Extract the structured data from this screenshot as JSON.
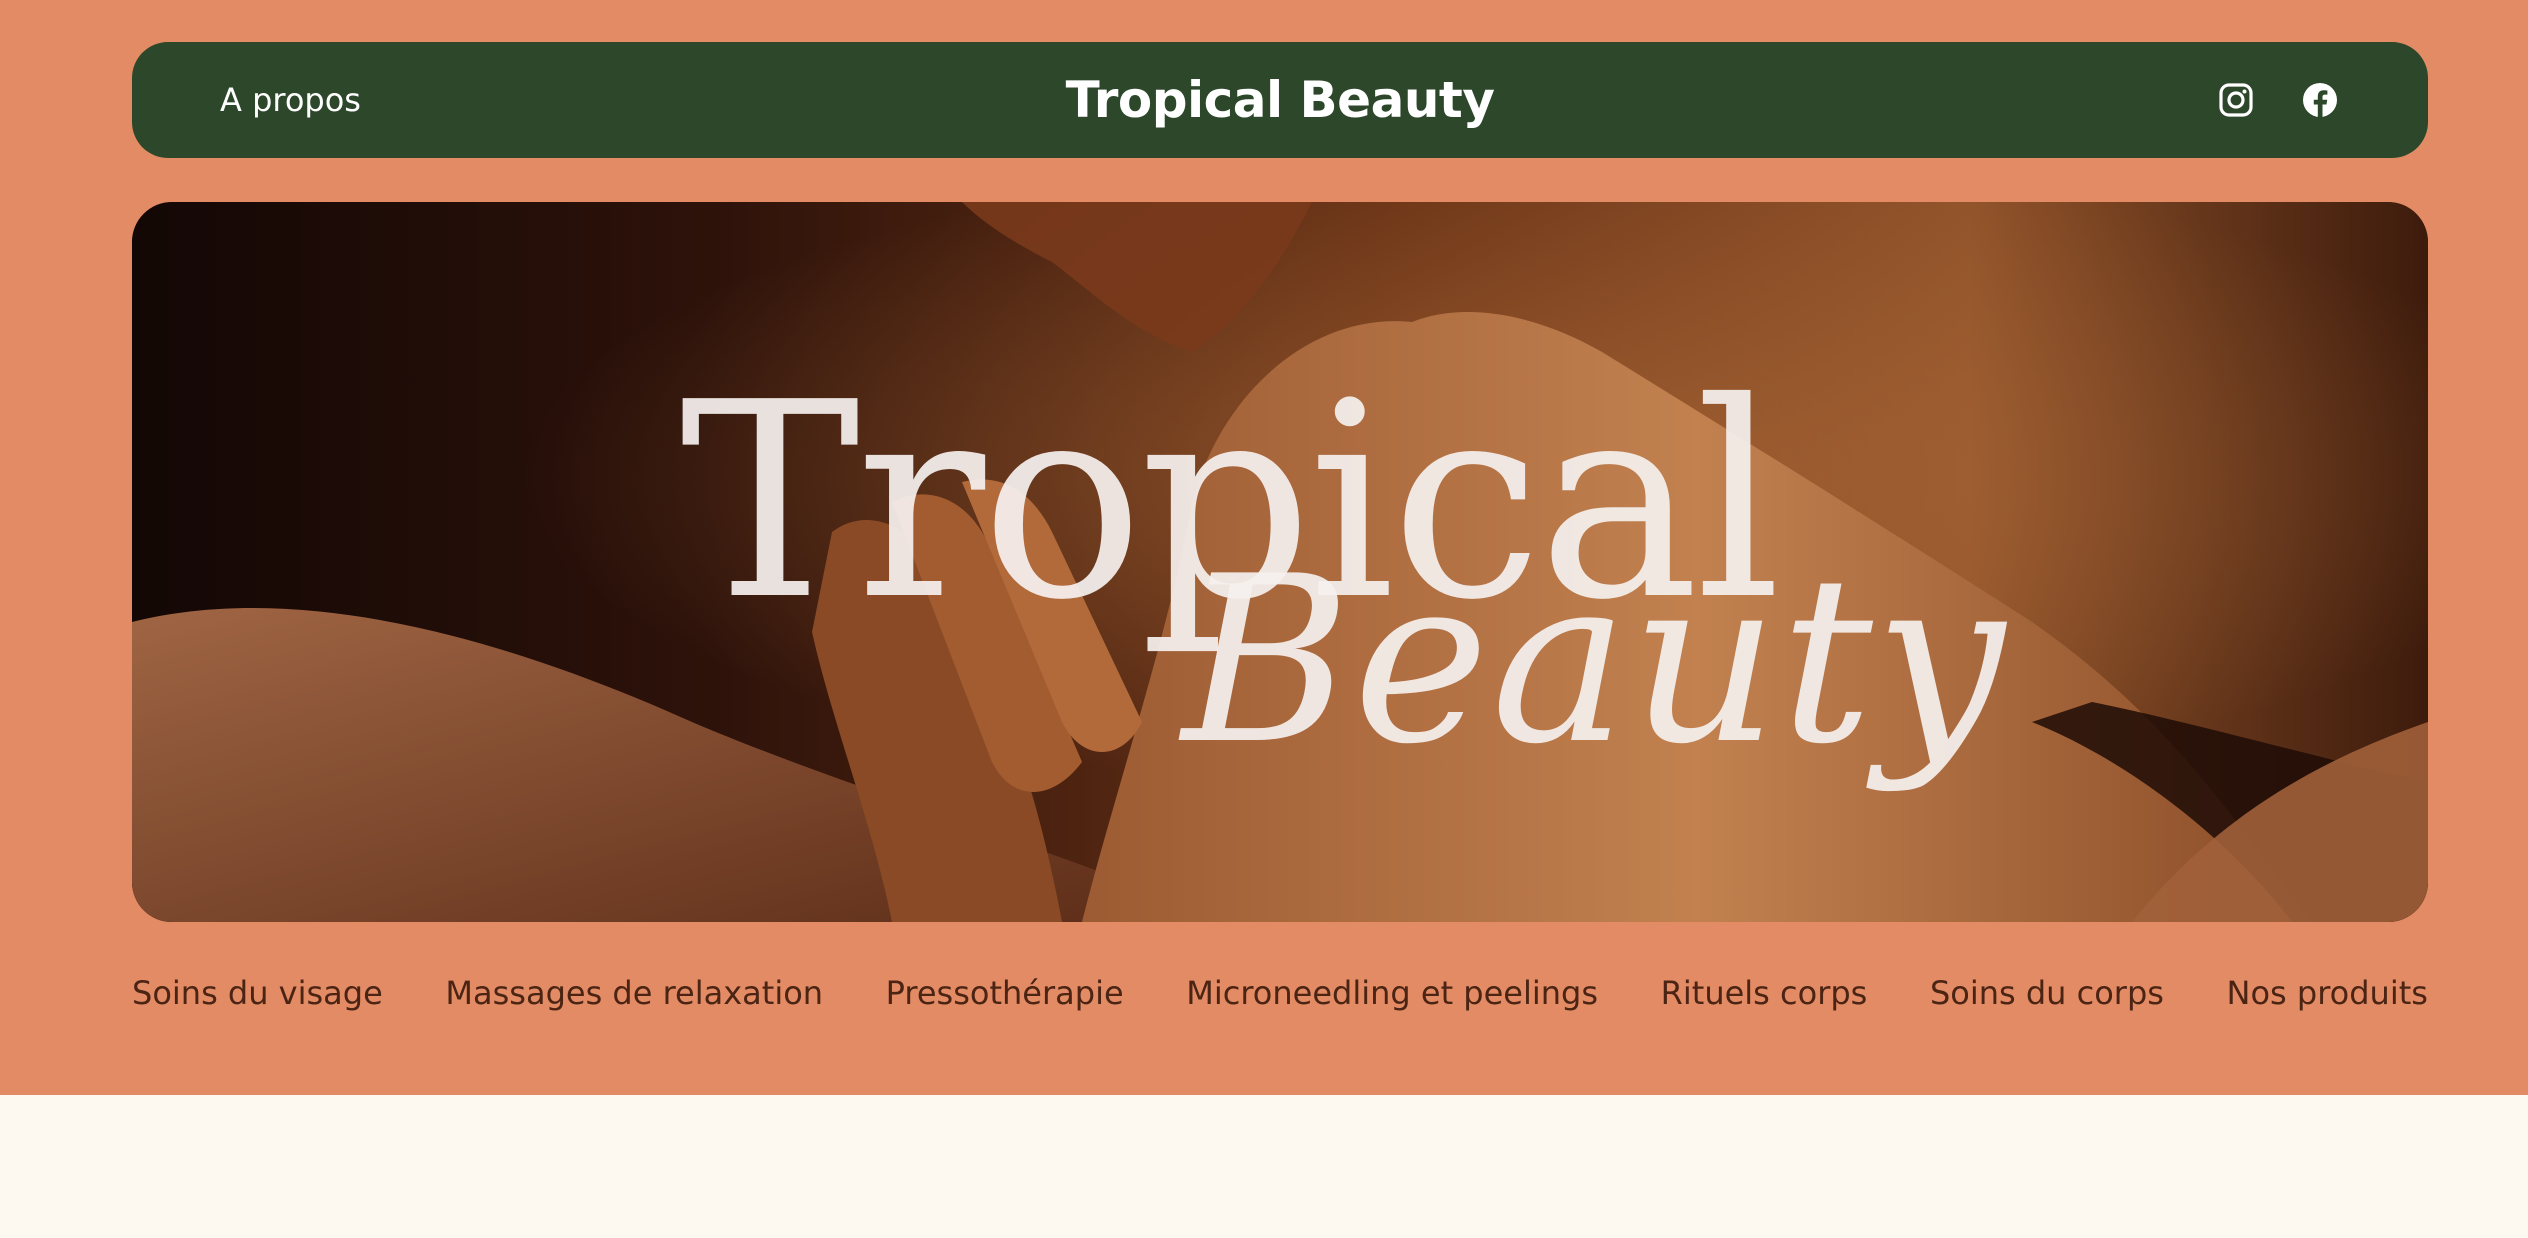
{
  "header": {
    "about_label": "A propos",
    "brand_title": "Tropical Beauty",
    "social_icons": [
      "instagram-icon",
      "facebook-icon"
    ]
  },
  "hero": {
    "logo_word_1": "Tropical",
    "logo_word_2": "Beauty"
  },
  "categories": [
    "Soins du visage",
    "Massages de relaxation",
    "Pressothérapie",
    "Microneedling et peelings",
    "Rituels corps",
    "Soins du corps",
    "Nos produits"
  ],
  "colors": {
    "top_background": "#e38b65",
    "navbar": "#2c472a",
    "page_background": "#fdf9f1",
    "category_text": "#4b2414",
    "nav_text": "#ffffff"
  }
}
